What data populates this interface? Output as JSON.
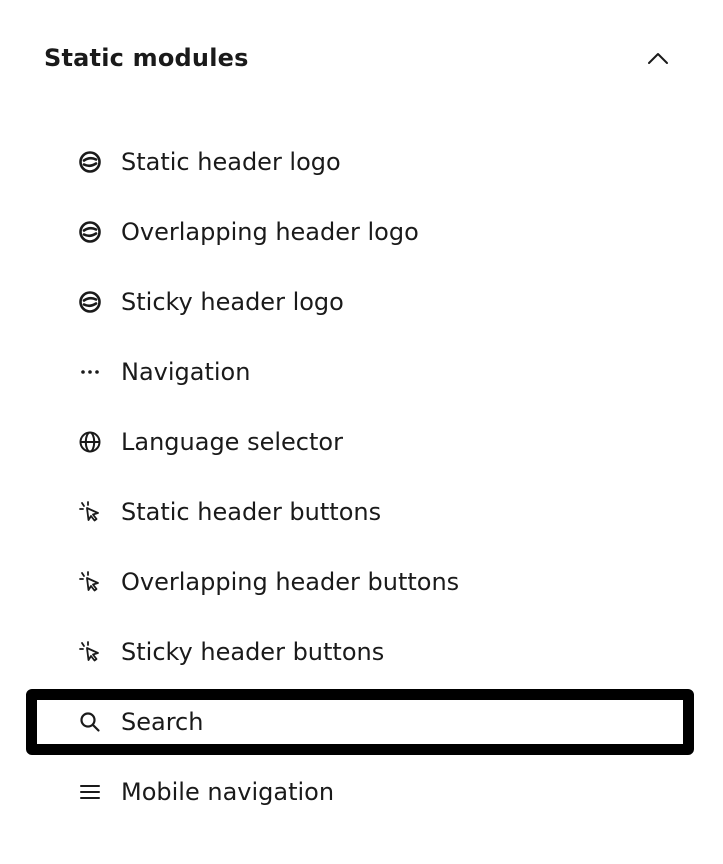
{
  "section": {
    "title": "Static modules",
    "expanded_icon": "chevron-up-icon"
  },
  "items": [
    {
      "label": "Static header logo",
      "icon": "logo-icon",
      "selected": false
    },
    {
      "label": "Overlapping header logo",
      "icon": "logo-icon",
      "selected": false
    },
    {
      "label": "Sticky header logo",
      "icon": "logo-icon",
      "selected": false
    },
    {
      "label": "Navigation",
      "icon": "ellipsis-icon",
      "selected": false
    },
    {
      "label": "Language selector",
      "icon": "globe-icon",
      "selected": false
    },
    {
      "label": "Static header buttons",
      "icon": "cursor-click-icon",
      "selected": false
    },
    {
      "label": "Overlapping header buttons",
      "icon": "cursor-click-icon",
      "selected": false
    },
    {
      "label": "Sticky header buttons",
      "icon": "cursor-click-icon",
      "selected": false
    },
    {
      "label": "Search",
      "icon": "search-icon",
      "selected": true
    },
    {
      "label": "Mobile navigation",
      "icon": "hamburger-menu-icon",
      "selected": false
    }
  ],
  "colors": {
    "text": "#1a1a1a",
    "selection_outline": "#000000",
    "background": "#ffffff"
  }
}
